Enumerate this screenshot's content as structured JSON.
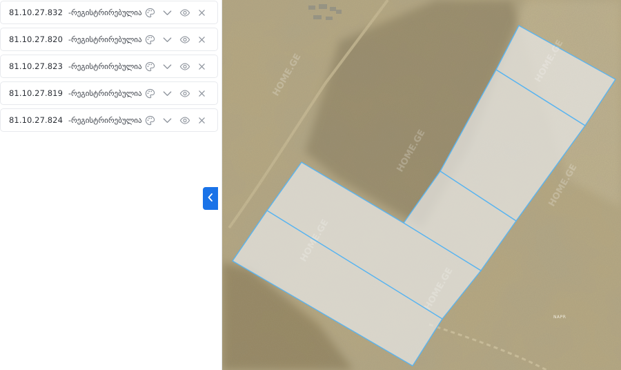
{
  "parcels": [
    {
      "code": "81.10.27.832",
      "status": "-რეგისტრირებულია"
    },
    {
      "code": "81.10.27.820",
      "status": "-რეგისტრირებულია"
    },
    {
      "code": "81.10.27.823",
      "status": "-რეგისტრირებულია"
    },
    {
      "code": "81.10.27.819",
      "status": "-რეგისტრირებულია"
    },
    {
      "code": "81.10.27.824",
      "status": "-რეგისტრირებულია"
    }
  ],
  "icons": {
    "color": "palette-icon",
    "expand": "chevron-down-icon",
    "visibility": "eye-icon",
    "remove": "close-icon",
    "collapse": "chevron-left-icon"
  },
  "map": {
    "label": "NAPR",
    "watermark": "HOME.GE"
  },
  "colors": {
    "accent": "#1a73e8",
    "parcel_outline": "#5ab4ef",
    "parcel_fill": "#e6e6e6"
  }
}
